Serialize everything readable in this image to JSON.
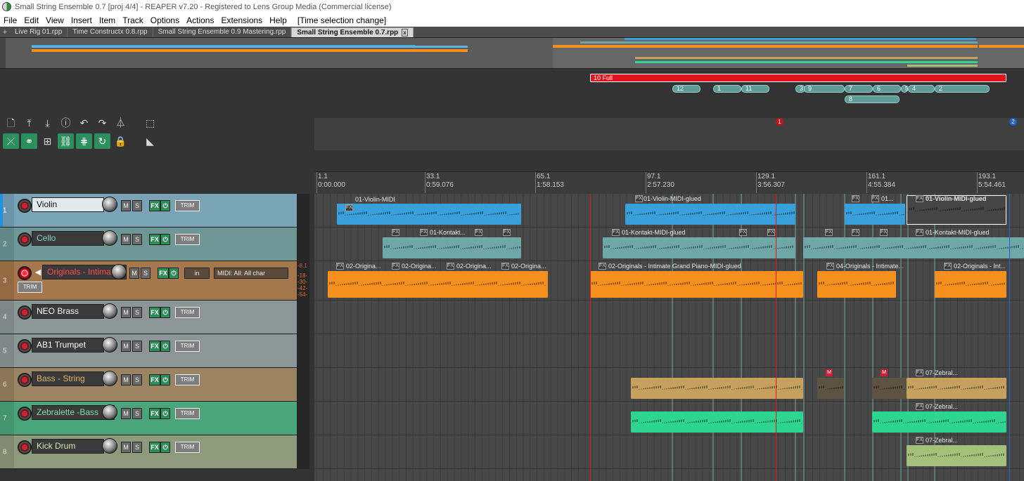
{
  "window": {
    "title": "Small String Ensemble 0.7 [proj 4/4] - REAPER v7.20 - Registered to Lens Group Media (Commercial license)"
  },
  "menu": {
    "items": [
      "File",
      "Edit",
      "View",
      "Insert",
      "Item",
      "Track",
      "Options",
      "Actions",
      "Extensions",
      "Help"
    ],
    "status": "[Time selection change]"
  },
  "tabs": {
    "plus": "+",
    "items": [
      {
        "label": "Live Rig 01.rpp",
        "active": false
      },
      {
        "label": "Time Constructx 0.8.rpp",
        "active": false
      },
      {
        "label": "Small String Ensemble 0.9 Mastering.rpp",
        "active": false
      },
      {
        "label": "Small String Ensemble 0.7.rpp",
        "active": true
      }
    ],
    "close_glyph": "x"
  },
  "toolbar": {
    "row1_icons": [
      "new-file-icon",
      "upload-icon",
      "download-icon",
      "info-icon",
      "undo-icon",
      "redo-icon",
      "metronome-icon",
      "grid-icon"
    ],
    "row2_icons": [
      "ripple-icon",
      "link-icon",
      "grid-snap-icon",
      "group-link-icon",
      "snap-grid-icon",
      "loop-icon",
      "lock-icon",
      "envelope-icon"
    ]
  },
  "timeline": {
    "region": {
      "label": "10 Full"
    },
    "markers_top": [
      "12",
      "1",
      "11",
      "3",
      "9",
      "7",
      "6",
      "5",
      "4",
      "2"
    ],
    "markers_second": [
      "8"
    ],
    "project_markers": [
      "1",
      "2"
    ],
    "ruler": [
      {
        "bar": "1.1",
        "time": "0:00.000"
      },
      {
        "bar": "33.1",
        "time": "0:59.076"
      },
      {
        "bar": "65.1",
        "time": "1:58.153"
      },
      {
        "bar": "97.1",
        "time": "2:57.230"
      },
      {
        "bar": "129.1",
        "time": "3:56.307"
      },
      {
        "bar": "161.1",
        "time": "4:55.384"
      },
      {
        "bar": "193.1",
        "time": "5:54.461"
      }
    ]
  },
  "tracks": [
    {
      "num": "1",
      "name": "Violin",
      "color": "#7aa3b8",
      "name_bg": "#dfe9ee",
      "name_fg": "#111111",
      "selected": true
    },
    {
      "num": "2",
      "name": "Cello",
      "color": "#6e9796",
      "name_bg": "#3b3b3b",
      "name_fg": "#8ed0cb",
      "selected": false
    },
    {
      "num": "3",
      "name": "Originals - Intima",
      "color": "#a5774c",
      "name_bg": "#3b3b3b",
      "name_fg": "#ff4a4a",
      "selected": false,
      "armed": true,
      "input": "in",
      "midi": "MIDI: All: All char",
      "meter_labels": [
        "-8.1",
        "-18-",
        "-30-",
        "-42-",
        "-54-"
      ]
    },
    {
      "num": "4",
      "name": "NEO Brass",
      "color": "#8c9696",
      "name_bg": "#3b3b3b",
      "name_fg": "#ffffff",
      "selected": false
    },
    {
      "num": "5",
      "name": "AB1 Trumpet",
      "color": "#8c9696",
      "name_bg": "#3b3b3b",
      "name_fg": "#ffffff",
      "selected": false
    },
    {
      "num": "6",
      "name": "Bass - String",
      "color": "#9a8461",
      "name_bg": "#3b3b3b",
      "name_fg": "#e2b36d",
      "selected": false
    },
    {
      "num": "7",
      "name": "Zebralette -Bass",
      "color": "#4aa67a",
      "name_bg": "#3b3b3b",
      "name_fg": "#7fe0a8",
      "selected": false
    },
    {
      "num": "8",
      "name": "Kick Drum",
      "color": "#8e9a7c",
      "name_bg": "#3b3b3b",
      "name_fg": "#d8e8b0",
      "selected": false
    }
  ],
  "track_buttons": {
    "mute": "M",
    "solo": "S",
    "fx": "FX",
    "power": "⏻",
    "trim": "TRIM"
  },
  "items": {
    "violin": [
      "01-Violin-MIDI",
      "01-Violin-MIDI-glued",
      "01...",
      "01-Violin-MIDI-glued"
    ],
    "cello": [
      "01-Kontakt...",
      "01-Kontakt-MIDI-glued",
      "01-Kontakt-MIDI-glued"
    ],
    "originals": [
      "02-Origina...",
      "02-Origina...",
      "02-Origina...",
      "02-Origina...",
      "02-Originals - Intimate Grand Piano-MIDI-glued",
      "04-Originals - Intimate...",
      "02-Originals - Int..."
    ],
    "bass": [
      "07-Zebral..."
    ],
    "zebralette": [
      "07-Zebral..."
    ],
    "kick": [
      "07-Zebral..."
    ],
    "fx_tag": "FX",
    "mute_tag": "M"
  },
  "colors": {
    "violin_item": "#3aa0dc",
    "cello_item": "#6fa7a7",
    "originals_item": "#f5901e",
    "bass_item": "#c6a05f",
    "zebra_item": "#2ed58e",
    "kick_item": "#a5c07a",
    "region": "#e0141c"
  }
}
